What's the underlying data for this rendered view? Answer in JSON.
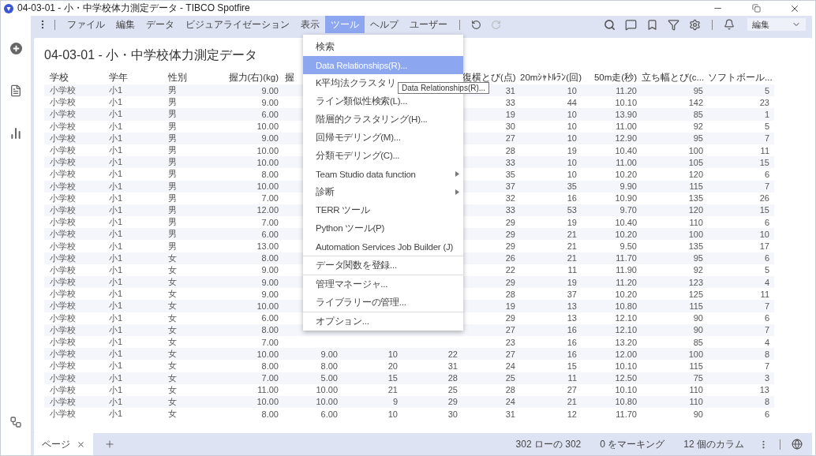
{
  "window": {
    "title": "04-03-01 - 小・中学校体力測定データ - TIBCO Spotfire"
  },
  "menubar": [
    {
      "label": "ファイル",
      "selected": false
    },
    {
      "label": "編集",
      "selected": false
    },
    {
      "label": "データ",
      "selected": false
    },
    {
      "label": "ビジュアライゼーション",
      "selected": false
    },
    {
      "label": "表示",
      "selected": false
    },
    {
      "label": "ツール",
      "selected": true
    },
    {
      "label": "ヘルプ",
      "selected": false
    },
    {
      "label": "ユーザー",
      "selected": false
    }
  ],
  "mode_dropdown": {
    "value": "編集"
  },
  "visualization": {
    "title": "04-03-01 - 小・中学校体力測定データ"
  },
  "table": {
    "columns": [
      {
        "label": "学校",
        "numeric": false
      },
      {
        "label": "学年",
        "numeric": false
      },
      {
        "label": "性別",
        "numeric": false
      },
      {
        "label": "握力(右)(kg)",
        "numeric": true
      },
      {
        "label": "握",
        "numeric": true,
        "clipped": true
      },
      {
        "numeric": true
      },
      {
        "numeric": true
      },
      {
        "label": "復横とび(点)",
        "numeric": true
      },
      {
        "label": "20mｼｬﾄﾙﾗﾝ(回)",
        "numeric": true
      },
      {
        "label": "50m走(秒)",
        "numeric": true
      },
      {
        "label": "立ち幅とび(c...",
        "numeric": true
      },
      {
        "label": "ソフトボール...",
        "numeric": true
      }
    ],
    "rows": [
      [
        "小学校",
        "小1",
        "男",
        "9.00",
        null,
        null,
        null,
        "31",
        "10",
        "11.20",
        "95",
        "5"
      ],
      [
        "小学校",
        "小1",
        "男",
        "9.00",
        null,
        null,
        null,
        "33",
        "44",
        "10.10",
        "142",
        "23"
      ],
      [
        "小学校",
        "小1",
        "男",
        "6.00",
        null,
        null,
        null,
        "19",
        "10",
        "13.90",
        "85",
        "1"
      ],
      [
        "小学校",
        "小1",
        "男",
        "10.00",
        null,
        null,
        null,
        "30",
        "10",
        "11.00",
        "92",
        "5"
      ],
      [
        "小学校",
        "小1",
        "男",
        "9.00",
        null,
        null,
        null,
        "27",
        "10",
        "12.90",
        "95",
        "7"
      ],
      [
        "小学校",
        "小1",
        "男",
        "10.00",
        null,
        null,
        null,
        "28",
        "19",
        "10.40",
        "100",
        "11"
      ],
      [
        "小学校",
        "小1",
        "男",
        "10.00",
        null,
        null,
        null,
        "33",
        "10",
        "11.00",
        "105",
        "15"
      ],
      [
        "小学校",
        "小1",
        "男",
        "8.00",
        null,
        null,
        null,
        "35",
        "10",
        "10.20",
        "120",
        "6"
      ],
      [
        "小学校",
        "小1",
        "男",
        "10.00",
        null,
        null,
        null,
        "37",
        "35",
        "9.90",
        "115",
        "7"
      ],
      [
        "小学校",
        "小1",
        "男",
        "7.00",
        null,
        null,
        null,
        "32",
        "16",
        "10.90",
        "135",
        "26"
      ],
      [
        "小学校",
        "小1",
        "男",
        "12.00",
        null,
        null,
        null,
        "33",
        "53",
        "9.70",
        "120",
        "15"
      ],
      [
        "小学校",
        "小1",
        "男",
        "7.00",
        null,
        null,
        null,
        "29",
        "19",
        "10.40",
        "110",
        "6"
      ],
      [
        "小学校",
        "小1",
        "男",
        "6.00",
        null,
        null,
        null,
        "29",
        "21",
        "10.20",
        "100",
        "10"
      ],
      [
        "小学校",
        "小1",
        "男",
        "13.00",
        null,
        null,
        null,
        "29",
        "21",
        "9.50",
        "135",
        "17"
      ],
      [
        "小学校",
        "小1",
        "女",
        "8.00",
        null,
        null,
        null,
        "26",
        "21",
        "11.70",
        "95",
        "6"
      ],
      [
        "小学校",
        "小1",
        "女",
        "9.00",
        null,
        null,
        null,
        "22",
        "11",
        "11.90",
        "92",
        "5"
      ],
      [
        "小学校",
        "小1",
        "女",
        "9.00",
        null,
        null,
        null,
        "29",
        "19",
        "11.20",
        "123",
        "4"
      ],
      [
        "小学校",
        "小1",
        "女",
        "9.00",
        null,
        null,
        null,
        "28",
        "37",
        "10.20",
        "125",
        "11"
      ],
      [
        "小学校",
        "小1",
        "女",
        "10.00",
        null,
        null,
        null,
        "19",
        "13",
        "10.80",
        "115",
        "7"
      ],
      [
        "小学校",
        "小1",
        "女",
        "6.00",
        null,
        null,
        null,
        "29",
        "13",
        "12.10",
        "90",
        "6"
      ],
      [
        "小学校",
        "小1",
        "女",
        "8.00",
        null,
        null,
        null,
        "27",
        "16",
        "12.10",
        "90",
        "7"
      ],
      [
        "小学校",
        "小1",
        "女",
        "7.00",
        null,
        null,
        null,
        "23",
        "16",
        "13.20",
        "85",
        "4"
      ],
      [
        "小学校",
        "小1",
        "女",
        "10.00",
        "9.00",
        "10",
        "22",
        "27",
        "16",
        "12.00",
        "100",
        "8"
      ],
      [
        "小学校",
        "小1",
        "女",
        "8.00",
        "8.00",
        "20",
        "31",
        "24",
        "15",
        "10.10",
        "115",
        "7"
      ],
      [
        "小学校",
        "小1",
        "女",
        "7.00",
        "5.00",
        "15",
        "28",
        "25",
        "11",
        "12.50",
        "75",
        "3"
      ],
      [
        "小学校",
        "小1",
        "女",
        "11.00",
        "10.00",
        "21",
        "25",
        "28",
        "27",
        "10.10",
        "110",
        "13"
      ],
      [
        "小学校",
        "小1",
        "女",
        "10.00",
        "10.00",
        "9",
        "29",
        "24",
        "21",
        "10.80",
        "110",
        "8"
      ],
      [
        "小学校",
        "小1",
        "女",
        "8.00",
        "6.00",
        "10",
        "30",
        "31",
        "12",
        "11.70",
        "90",
        "6"
      ]
    ]
  },
  "tools_menu": {
    "sections": [
      [
        {
          "label": "検索",
          "selected": false,
          "submenu": false
        },
        {
          "label": "Data Relationships(R)...",
          "selected": true,
          "submenu": false
        },
        {
          "label": "K平均法クラスタリ",
          "selected": false,
          "submenu": false,
          "tooltip": "Data Relationships(R)..."
        },
        {
          "label": "ライン類似性検索(L)...",
          "selected": false,
          "submenu": false
        },
        {
          "label": "階層的クラスタリング(H)...",
          "selected": false,
          "submenu": false
        },
        {
          "label": "回帰モデリング(M)...",
          "selected": false,
          "submenu": false
        },
        {
          "label": "分類モデリング(C)...",
          "selected": false,
          "submenu": false
        },
        {
          "label": "Team Studio data function",
          "selected": false,
          "submenu": true
        },
        {
          "label": "診断",
          "selected": false,
          "submenu": true
        },
        {
          "label": "TERR ツール",
          "selected": false,
          "submenu": false
        },
        {
          "label": "Python ツール(P)",
          "selected": false,
          "submenu": false
        },
        {
          "label": "Automation Services Job Builder (J)",
          "selected": false,
          "submenu": false
        }
      ],
      [
        {
          "label": "データ関数を登録...",
          "selected": false,
          "submenu": false
        }
      ],
      [
        {
          "label": "管理マネージャ...",
          "selected": false,
          "submenu": false
        },
        {
          "label": "ライブラリーの管理...",
          "selected": false,
          "submenu": false
        }
      ],
      [
        {
          "label": "オプション...",
          "selected": false,
          "submenu": false
        }
      ]
    ]
  },
  "status_bar": {
    "page_tab": "ページ",
    "items": [
      "302 ローの 302",
      "0 をマーキング",
      "12 個のカラム"
    ]
  }
}
